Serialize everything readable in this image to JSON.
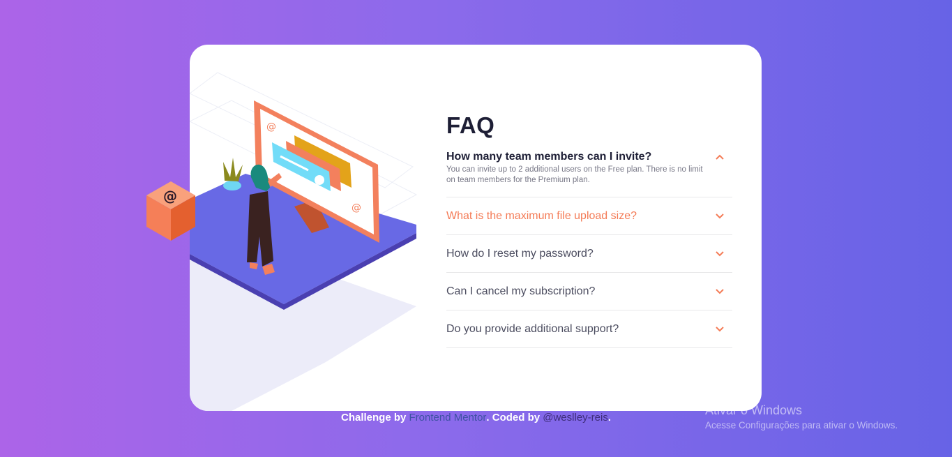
{
  "faq": {
    "title": "FAQ",
    "items": [
      {
        "question": "How many team members can I invite?",
        "answer": "You can invite up to 2 additional users on the Free plan. There is no limit on team members for the Premium plan.",
        "state": "open"
      },
      {
        "question": "What is the maximum file upload size?",
        "state": "hover"
      },
      {
        "question": "How do I reset my password?",
        "state": "closed"
      },
      {
        "question": "Can I cancel my subscription?",
        "state": "closed"
      },
      {
        "question": "Do you provide additional support?",
        "state": "closed"
      }
    ]
  },
  "footer": {
    "prefix": "Challenge by ",
    "link1": "Frontend Mentor",
    "middle": ". Coded by ",
    "link2": "@weslley-reis",
    "suffix": "."
  },
  "watermark": {
    "title": "Ativar o Windows",
    "subtitle": "Acesse Configurações para ativar o Windows."
  },
  "colors": {
    "accent": "#f47b56",
    "heading": "#1d1e35",
    "bg_start": "#ac64e8",
    "bg_end": "#6763e6"
  }
}
